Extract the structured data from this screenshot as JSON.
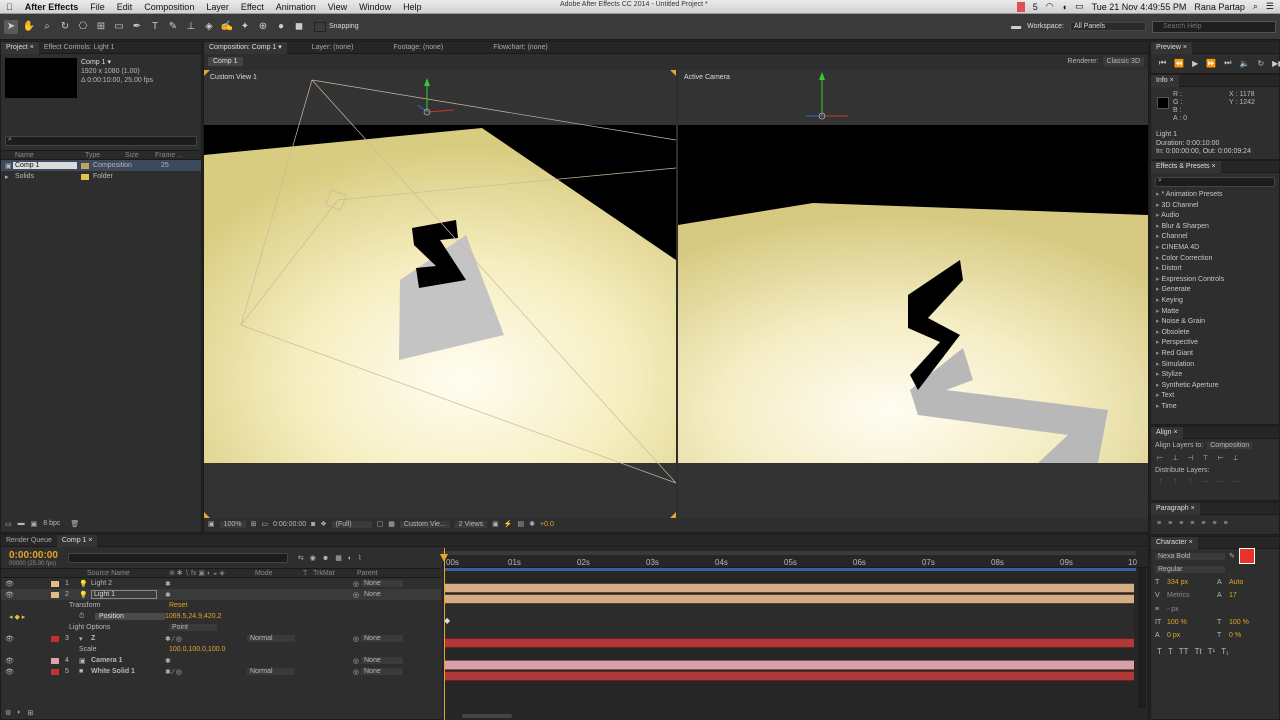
{
  "menubar": {
    "apple": "",
    "app": "After Effects",
    "items": [
      "File",
      "Edit",
      "Composition",
      "Layer",
      "Effect",
      "Animation",
      "View",
      "Window",
      "Help"
    ],
    "window_title": "Adobe After Effects CC 2014 - Untitled Project *",
    "badge": "5",
    "clock": "Tue 21 Nov  4:49:55 PM",
    "user": "Rana Partap"
  },
  "toolbar": {
    "snapping": "Snapping",
    "workspace_label": "Workspace:",
    "workspace_value": "All Panels",
    "search_placeholder": "Search Help"
  },
  "project": {
    "tabs": [
      "Project ×",
      "Effect Controls: Light 1"
    ],
    "item_name": "Comp 1 ▾",
    "item_info1": "1920 x 1080 (1.00)",
    "item_info2": "Δ 0:00:10:00, 25.00 fps",
    "columns": [
      "Name",
      "Type",
      "Size",
      "Frame ..."
    ],
    "rows": [
      {
        "name": "Comp 1",
        "type": "Composition",
        "size": "",
        "frame": "25",
        "color": "#bfa45a"
      },
      {
        "name": "Solids",
        "type": "Folder",
        "size": "",
        "frame": "",
        "color": "#e4c14a"
      }
    ],
    "bpc": "8 bpc"
  },
  "composition": {
    "tabs": [
      "Composition: Comp 1 ▾",
      "Layer: (none)",
      "Footage: (none)",
      "Flowchart: (none)"
    ],
    "comp_tab": "Comp 1",
    "renderer_label": "Renderer:",
    "renderer_value": "Classic 3D",
    "view_left": "Custom View 1",
    "view_right": "Active Camera",
    "footer": {
      "zoom": "100%",
      "time": "0:00:00:00",
      "resolution": "(Full)",
      "view": "Custom Vie...",
      "views": "2 Views",
      "exposure": "+0.0"
    }
  },
  "right": {
    "preview_tab": "Preview ×",
    "info_tab": "Info ×",
    "info": {
      "r": "R :",
      "g": "G :",
      "b": "B :",
      "a": "A : 0",
      "x": "X : 1178",
      "y": "Y : 1242"
    },
    "info_layer": "Light 1",
    "info_duration": "Duration: 0:00:10:00",
    "info_inout": "In: 0:00:00:00, Out: 0:00:09:24",
    "effects_tab": "Effects & Presets ×",
    "effects": [
      "* Animation Presets",
      "3D Channel",
      "Audio",
      "Blur & Sharpen",
      "Channel",
      "CINEMA 4D",
      "Color Correction",
      "Distort",
      "Expression Controls",
      "Generate",
      "Keying",
      "Matte",
      "Noise & Grain",
      "Obsolete",
      "Perspective",
      "Red Giant",
      "Simulation",
      "Stylize",
      "Synthetic Aperture",
      "Text",
      "Time"
    ],
    "align_tab": "Align ×",
    "align_to_label": "Align Layers to:",
    "align_to_value": "Composition",
    "distribute_label": "Distribute Layers:",
    "paragraph_tab": "Paragraph ×",
    "character_tab": "Character ×",
    "font": "Nexa Bold",
    "style": "Regular",
    "size": "334 px",
    "leading": "Auto",
    "kerning": "Metrics",
    "tracking": "17",
    "stroke": "- px",
    "vscale": "100 %",
    "hscale": "100 %",
    "baseline": "0 px",
    "tsume": "0 %",
    "color_fill": "#e8322a"
  },
  "timeline": {
    "tabs": [
      "Render Queue",
      "Comp 1 ×"
    ],
    "timecode": "0:00:00:00",
    "frames": "00000 (25.00 fps)",
    "columns": {
      "source": "Source Name",
      "mode": "Mode",
      "t": "T",
      "trkmat": "TrkMat",
      "parent": "Parent"
    },
    "ruler": [
      "00s",
      "01s",
      "02s",
      "03s",
      "04s",
      "05s",
      "06s",
      "07s",
      "08s",
      "09s",
      "10"
    ],
    "layers": [
      {
        "num": "1",
        "name": "Light 2",
        "mode": "",
        "parent": "None",
        "color": "#e4b98a",
        "bar": "#c9a27c"
      },
      {
        "num": "2",
        "name": "Light 1",
        "mode": "",
        "parent": "None",
        "color": "#e4b98a",
        "bar": "#c9a27c"
      },
      {
        "num": "3",
        "name": "Z",
        "mode": "Normal",
        "parent": "None",
        "color": "#c23030",
        "bar": "#b03838"
      },
      {
        "num": "4",
        "name": "Camera 1",
        "mode": "",
        "parent": "None",
        "color": "#e0a0a8",
        "bar": "#c9949c"
      },
      {
        "num": "5",
        "name": "White Solid 1",
        "mode": "Normal",
        "parent": "None",
        "color": "#c23030",
        "bar": "#b03838"
      }
    ],
    "props": {
      "transform": "Transform",
      "reset": "Reset",
      "position_label": "Position",
      "position_value": "1069.5,24.9,420.2",
      "light_options": "Light Options",
      "light_type": "Point",
      "scale_label": "Scale",
      "scale_value": "100.0,100.0,100.0"
    }
  }
}
